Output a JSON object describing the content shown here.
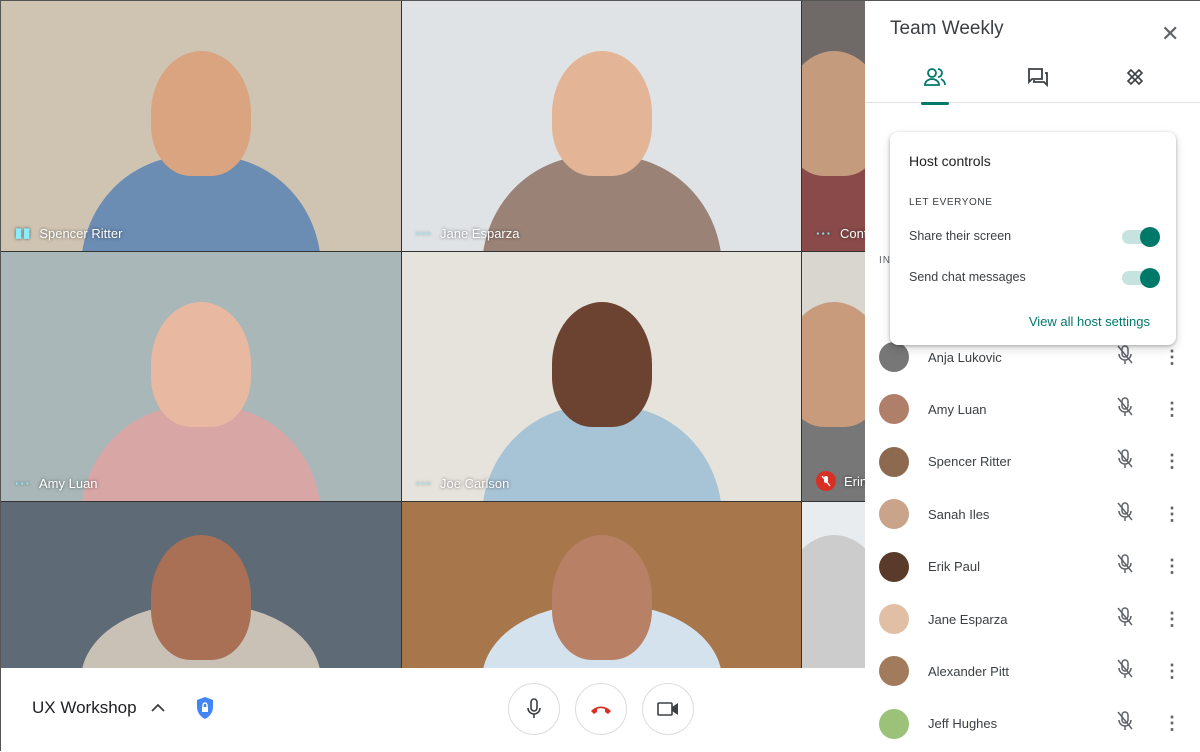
{
  "meeting": {
    "title": "UX Workshop",
    "chevron_icon": "chevron-up-icon",
    "security_icon": "shield-lock-icon"
  },
  "controls": {
    "mic": "microphone-icon",
    "hangup": "hang-up-icon",
    "camera": "video-camera-icon",
    "hangup_color": "#d93025"
  },
  "tiles": [
    {
      "name": "Spencer Ritter",
      "indicator": "speaking-bars",
      "bg": "#cfc3b2",
      "skin": "#d9a47f",
      "shirt": "#6b8cb3"
    },
    {
      "name": "Jane Esparza",
      "indicator": "dots",
      "bg": "#dfe3e6",
      "skin": "#e3b596",
      "shirt": "#9a8276"
    },
    {
      "name": "Cont",
      "indicator": "dots",
      "bg": "#6f6a68",
      "skin": "#c59b7e",
      "shirt": "#8a4a4a"
    },
    {
      "name": "Amy Luan",
      "indicator": "dots",
      "bg": "#a9b7b9",
      "skin": "#e8b9a0",
      "shirt": "#d9a6a6"
    },
    {
      "name": "Joe Carlson",
      "indicator": "dots",
      "bg": "#e6e2dc",
      "skin": "#6b4330",
      "shirt": "#a7c3d6"
    },
    {
      "name": "Erin",
      "indicator": "muted",
      "bg": "#d9d6d0",
      "skin": "#c79b7b",
      "shirt": "#777"
    },
    {
      "name": "",
      "indicator": "",
      "bg": "#5f6a77",
      "skin": "#a97056",
      "shirt": "#c9c0b6"
    },
    {
      "name": "",
      "indicator": "",
      "bg": "#a7764a",
      "skin": "#b88064",
      "shirt": "#d4e2ee"
    },
    {
      "name": "",
      "indicator": "",
      "bg": "#e9ecef",
      "skin": "#ccc",
      "shirt": "#ccc"
    }
  ],
  "panel": {
    "title": "Team Weekly",
    "close_icon": "close-icon",
    "tabs": [
      {
        "icon": "people-icon",
        "active": true
      },
      {
        "icon": "chat-icon"
      },
      {
        "icon": "activities-icon"
      }
    ],
    "section_label": "IN",
    "participants": [
      {
        "name": "Anja Lukovic",
        "color": "#777"
      },
      {
        "name": "Amy Luan",
        "color": "#b07f6a"
      },
      {
        "name": "Spencer Ritter",
        "color": "#8d6a4f"
      },
      {
        "name": "Sanah Iles",
        "color": "#caa48a"
      },
      {
        "name": "Erik Paul",
        "color": "#5a3a2a"
      },
      {
        "name": "Jane Esparza",
        "color": "#e0bfa5"
      },
      {
        "name": "Alexander Pitt",
        "color": "#a27a5c"
      },
      {
        "name": "Jeff Hughes",
        "color": "#9cc27a"
      }
    ]
  },
  "host_controls": {
    "title": "Host controls",
    "section": "LET EVERYONE",
    "options": [
      {
        "label": "Share their screen",
        "on": true
      },
      {
        "label": "Send chat messages",
        "on": true
      }
    ],
    "link": "View all host settings",
    "accent": "#00796b"
  }
}
